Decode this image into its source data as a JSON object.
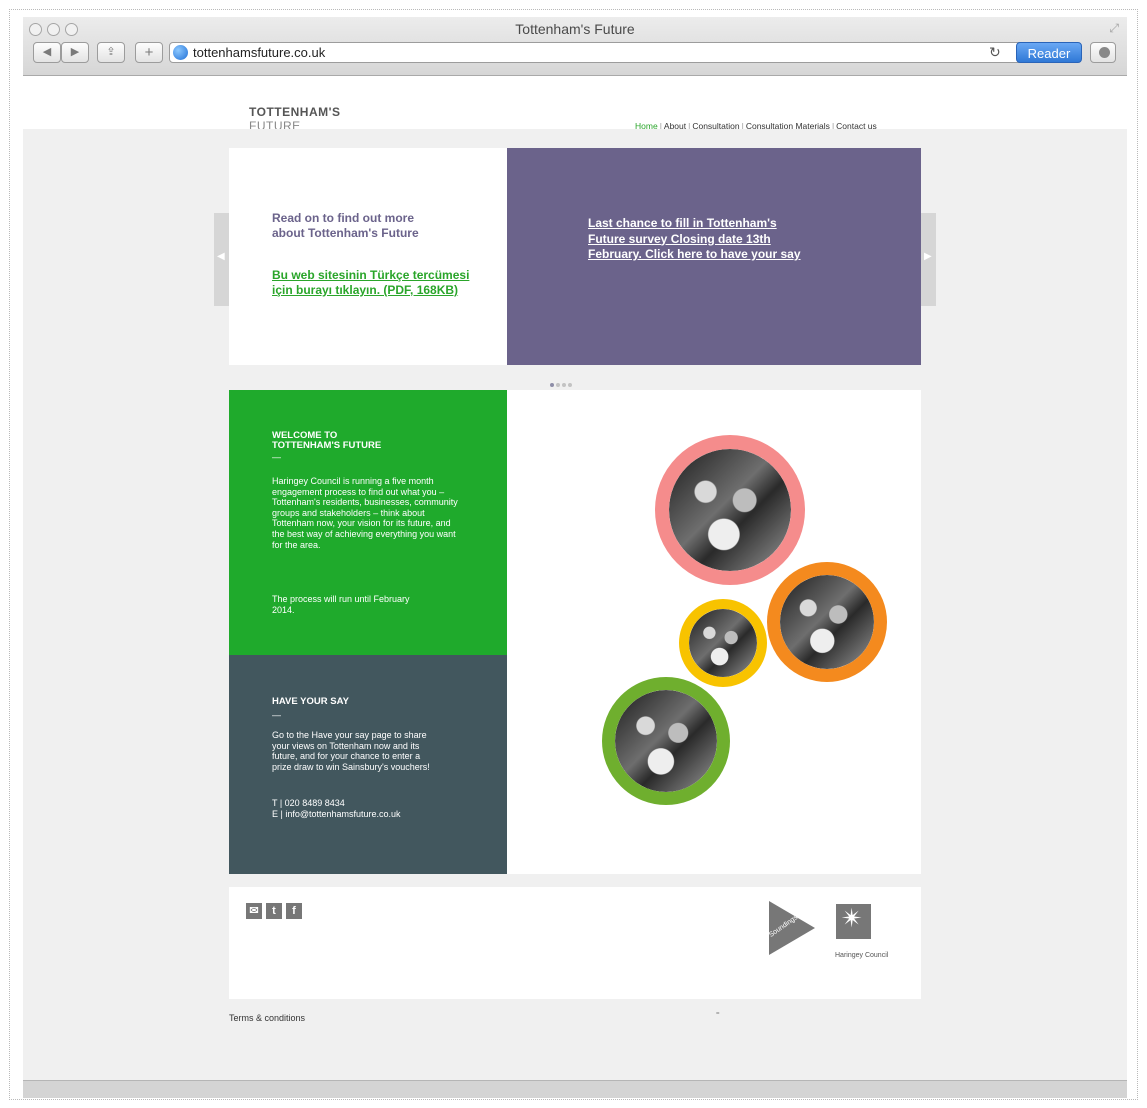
{
  "browser": {
    "window_title": "Tottenham's Future",
    "url": "tottenhamsfuture.co.uk",
    "reader_label": "Reader",
    "back_glyph": "◀",
    "forward_glyph": "▶",
    "share_glyph": "⇪",
    "add_glyph": "+",
    "reload_glyph": "↻",
    "resize_glyph": "⤢"
  },
  "header": {
    "logo_line1": "TOTTENHAM'S",
    "logo_line2": "FUTURE",
    "nav": [
      {
        "label": "Home",
        "active": true
      },
      {
        "label": "About"
      },
      {
        "label": "Consultation"
      },
      {
        "label": "Consultation Materials"
      },
      {
        "label": "Contact us"
      }
    ]
  },
  "slider": {
    "intro_text": "Read on to find out more about Tottenham's Future",
    "turkish_link": "Bu web sitesinin Türkçe tercümesi için burayı tıklayın. (PDF, 168KB)",
    "survey_link": "Last chance to fill in Tottenham's Future survey Closing date 13th February. Click here to have your say",
    "prev_glyph": "◀",
    "next_glyph": "▶",
    "dots_total": 4,
    "active_dot": 1
  },
  "welcome": {
    "title_line1": "WELCOME TO",
    "title_line2": "TOTTENHAM'S FUTURE",
    "dash": "—",
    "body": "Haringey Council is running a five month engagement process to find out what you – Tottenham's residents, businesses, community groups and stakeholders – think about Tottenham now, your vision for its future, and the best way of achieving everything you want for the area.",
    "body2": "The process will run until February 2014."
  },
  "have_your_say": {
    "title": "HAVE YOUR SAY",
    "dash": "—",
    "text_before": "Go to the ",
    "link_text": "Have your say",
    "text_after": " page to share your views on Tottenham now and its future, and for your chance to enter a prize draw to win Sainsbury's vouchers!",
    "phone": "T | 020 8489 8434",
    "email": "E | info@tottenhamsfuture.co.uk"
  },
  "images": {
    "ring_colors": [
      "#f58c8c",
      "#f48a1e",
      "#f8c300",
      "#6faf2e"
    ]
  },
  "footer": {
    "email_icon": "✉",
    "twitter_icon": "t",
    "facebook_icon": "f",
    "soundings_label": "Soundings",
    "haringey_label": "Haringey Council",
    "haringey_star": "✴",
    "terms": "Terms & conditions",
    "tiny_mark": "="
  },
  "colors": {
    "brand_green": "#1faa2c",
    "purple": "#6b638b",
    "slate": "#42575e"
  }
}
